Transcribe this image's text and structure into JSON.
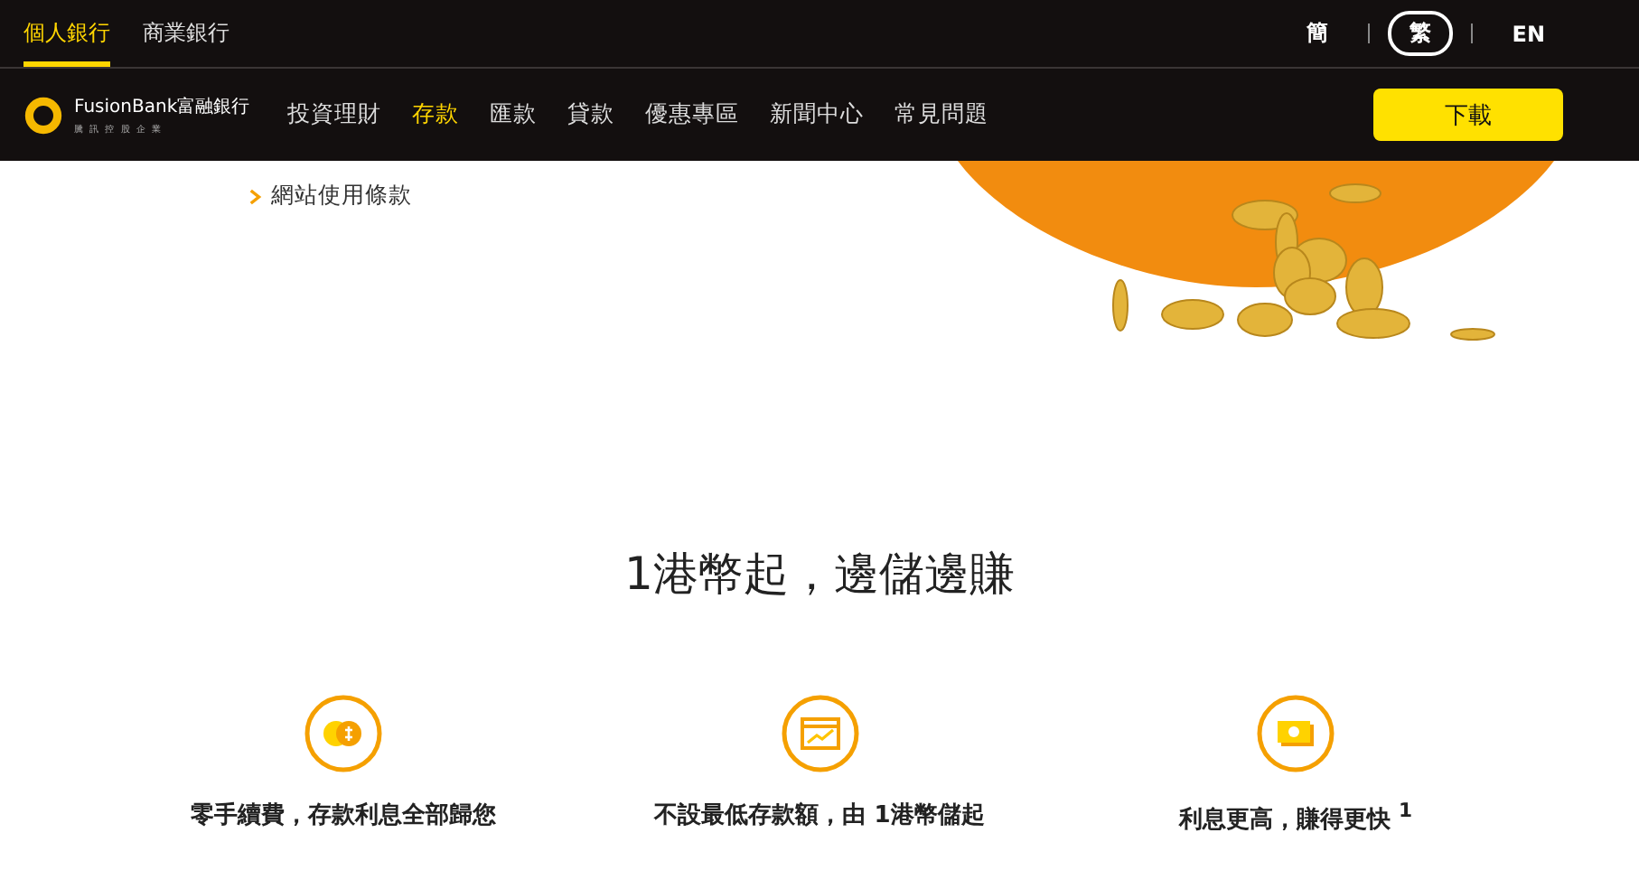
{
  "top_tabs": [
    {
      "label": "個人銀行",
      "selected": true
    },
    {
      "label": "商業銀行",
      "selected": false
    }
  ],
  "languages": [
    {
      "label": "簡",
      "selected": false
    },
    {
      "label": "繁",
      "selected": true
    },
    {
      "label": "EN",
      "selected": false
    }
  ],
  "logo": {
    "name": "FusionBank富融銀行",
    "tagline": "騰 訊 控 股 企 業"
  },
  "nav": [
    {
      "label": "投資理財",
      "selected": false
    },
    {
      "label": "存款",
      "selected": true
    },
    {
      "label": "匯款",
      "selected": false
    },
    {
      "label": "貸款",
      "selected": false
    },
    {
      "label": "優惠專區",
      "selected": false
    },
    {
      "label": "新聞中心",
      "selected": false
    },
    {
      "label": "常見問題",
      "selected": false
    }
  ],
  "download_button": "下載",
  "links": [
    "網站使用條款"
  ],
  "heading": "1港幣起，邊儲邊賺",
  "features": [
    {
      "kind": "coins",
      "text": "零手續費，存款利息全部歸您"
    },
    {
      "kind": "chart",
      "text": "不設最低存款額，由 1港幣儲起"
    },
    {
      "kind": "cash",
      "text": "利息更高，賺得更快 $^{1}$"
    }
  ]
}
